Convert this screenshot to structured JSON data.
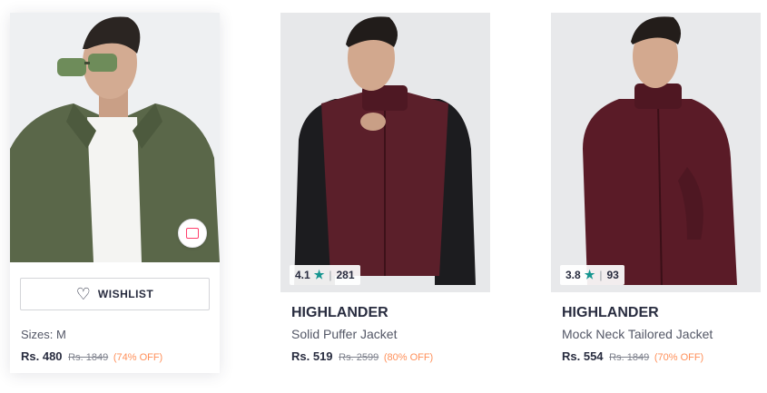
{
  "products": [
    {
      "wishlist_label": "WISHLIST",
      "sizes": "Sizes: M",
      "price": "Rs. 480",
      "mrp": "Rs. 1849",
      "discount": "(74% OFF)",
      "image_desc": "olive-jacket"
    },
    {
      "rating": "4.1",
      "rating_count": "281",
      "brand": "HIGHLANDER",
      "name": "Solid Puffer Jacket",
      "price": "Rs. 519",
      "mrp": "Rs. 2599",
      "discount": "(80% OFF)",
      "image_desc": "maroon-puffer"
    },
    {
      "rating": "3.8",
      "rating_count": "93",
      "brand": "HIGHLANDER",
      "name": "Mock Neck Tailored Jacket",
      "price": "Rs. 554",
      "mrp": "Rs. 1849",
      "discount": "(70% OFF)",
      "image_desc": "maroon-mock-neck"
    }
  ],
  "colors": {
    "rating_star": "#14958f",
    "discount": "#ff905a",
    "accent": "#ff3f6c"
  }
}
